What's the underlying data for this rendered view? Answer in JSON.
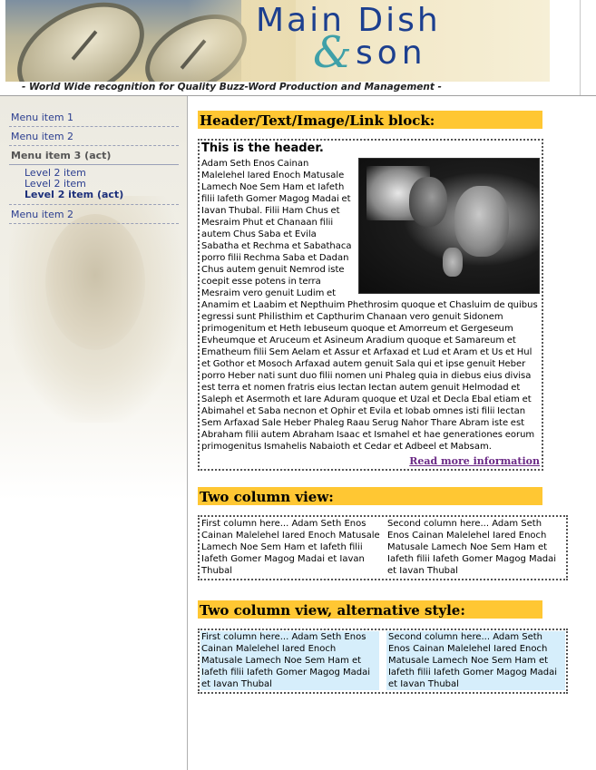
{
  "header": {
    "brand_main": "Main Dish",
    "brand_amp": "&",
    "brand_son": "son",
    "tagline": "- World Wide recognition for Quality Buzz-Word Production and Management -"
  },
  "sidebar": {
    "items": [
      {
        "label": "Menu item 1"
      },
      {
        "label": "Menu item 2"
      },
      {
        "label": "Menu item 3 (act)"
      },
      {
        "label": "Level 2 item"
      },
      {
        "label": "Level 2 item"
      },
      {
        "label": "Level 2 item (act)"
      },
      {
        "label": "Menu item 2"
      }
    ]
  },
  "sections": {
    "block": {
      "heading": "Header/Text/Image/Link block:",
      "title": "This is the header.",
      "body": "Adam Seth Enos Cainan Malelehel Iared Enoch Matusale Lamech Noe Sem Ham et Iafeth filii Iafeth Gomer Magog Madai et Iavan Thubal. Filii Ham Chus et Mesraim Phut et Chanaan filii autem Chus Saba et Evila Sabatha et Rechma et Sabathaca porro filii Rechma Saba et Dadan Chus autem genuit Nemrod iste coepit esse potens in terra Mesraim vero genuit Ludim et Anamim et Laabim et Nepthuim Phethrosim quoque et Chasluim de quibus egressi sunt Philisthim et Capthurim Chanaan vero genuit Sidonem primogenitum et Heth Iebuseum quoque et Amorreum et Gergeseum Evheumque et Aruceum et Asineum Aradium quoque et Samareum et Ematheum filii Sem Aelam et Assur et Arfaxad et Lud et Aram et Us et Hul et Gothor et Mosoch Arfaxad autem genuit Sala qui et ipse genuit Heber porro Heber nati sunt duo filii nomen uni Phaleg quia in diebus eius divisa est terra et nomen fratris eius Iectan Iectan autem genuit Helmodad et Saleph et Asermoth et Iare Aduram quoque et Uzal et Decla Ebal etiam et Abimahel et Saba necnon et Ophir et Evila et Iobab omnes isti filii Iectan Sem Arfaxad Sale Heber Phaleg Raau Serug Nahor Thare Abram iste est Abraham filii autem Abraham Isaac et Ismahel et hae generationes eorum primogenitus Ismahelis Nabaioth et Cedar et Adbeel et Mabsam.",
      "link": "Read more information"
    },
    "two_col": {
      "heading": "Two column view:",
      "col1": "First column here... Adam Seth Enos Cainan Malelehel Iared Enoch Matusale Lamech Noe Sem Ham et Iafeth filii Iafeth Gomer Magog Madai et Iavan Thubal",
      "col2": "Second column here... Adam Seth Enos Cainan Malelehel Iared Enoch Matusale Lamech Noe Sem Ham et Iafeth filii Iafeth Gomer Magog Madai et Iavan Thubal"
    },
    "two_col_alt": {
      "heading": "Two column view, alternative style:",
      "col1": "First column here... Adam Seth Enos Cainan Malelehel Iared Enoch Matusale Lamech Noe Sem Ham et Iafeth filii Iafeth Gomer Magog Madai et Iavan Thubal",
      "col2": "Second column here... Adam Seth Enos Cainan Malelehel Iared Enoch Matusale Lamech Noe Sem Ham et Iafeth filii Iafeth Gomer Magog Madai et Iavan Thubal"
    }
  },
  "colors": {
    "accent_bar": "#ffc733",
    "menu_link": "#2a3d8f",
    "brand_blue": "#1c3f8f",
    "alt_column_bg": "#d6eefb",
    "visited_link": "#6b2a86"
  },
  "icons": [
    "satellite-dish-banner-image",
    "portrait-image",
    "movie-still-image"
  ]
}
